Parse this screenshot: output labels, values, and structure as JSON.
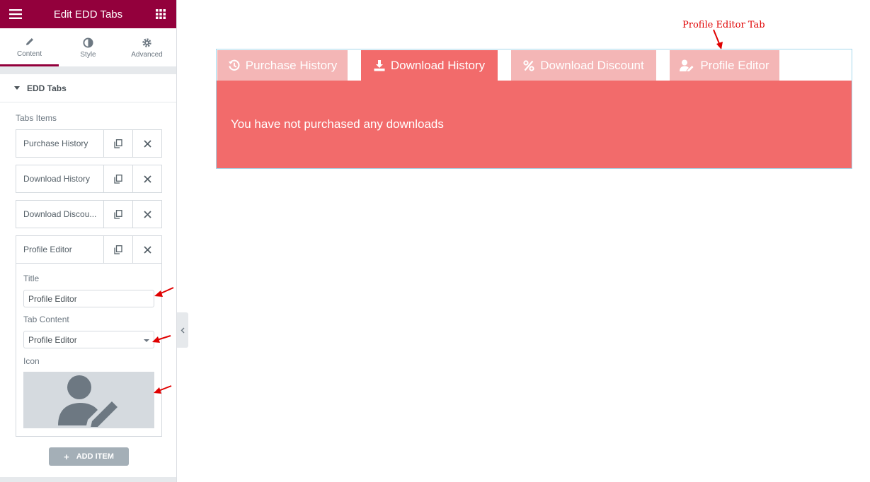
{
  "sidebar": {
    "header_title": "Edit EDD Tabs",
    "tabs": [
      {
        "label": "Content"
      },
      {
        "label": "Style"
      },
      {
        "label": "Advanced"
      }
    ],
    "section_title": "EDD Tabs",
    "tabs_items_label": "Tabs Items",
    "items": [
      {
        "title": "Purchase History"
      },
      {
        "title": "Download History"
      },
      {
        "title": "Download Discou..."
      },
      {
        "title": "Profile Editor"
      }
    ],
    "expanded": {
      "title_label": "Title",
      "title_value": "Profile Editor",
      "content_label": "Tab Content",
      "content_value": "Profile Editor",
      "icon_label": "Icon"
    },
    "add_item_label": "ADD ITEM"
  },
  "preview": {
    "tabs": [
      {
        "label": "Purchase History",
        "icon": "history-icon",
        "active": false
      },
      {
        "label": "Download History",
        "icon": "download-icon",
        "active": true
      },
      {
        "label": "Download Discount",
        "icon": "percent-icon",
        "active": false
      },
      {
        "label": "Profile Editor",
        "icon": "user-edit-icon",
        "active": false
      }
    ],
    "content_text": "You have not purchased any downloads"
  },
  "annotation": {
    "label": "Profile Editor Tab"
  },
  "colors": {
    "brand": "#93003c",
    "tab_active": "#f26b6b",
    "tab_inactive": "#f4b6b6",
    "annotation": "#e00000"
  }
}
